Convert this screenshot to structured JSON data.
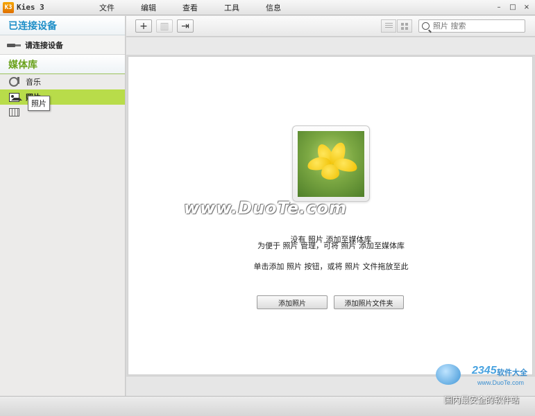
{
  "app": {
    "logo_text": "K3",
    "title": "Kies 3"
  },
  "menu": [
    "文件",
    "编辑",
    "查看",
    "工具",
    "信息"
  ],
  "window_controls": {
    "minimize": "–",
    "maximize": "□",
    "close": "×"
  },
  "sidebar": {
    "connected_header": "已连接设备",
    "device_prompt": "请连接设备",
    "library_header": "媒体库",
    "items": [
      {
        "label": "音乐",
        "icon": "music-icon",
        "selected": false
      },
      {
        "label": "照片",
        "icon": "photo-icon",
        "selected": true
      },
      {
        "label": "视频",
        "icon": "video-icon",
        "selected": false
      }
    ],
    "tooltip": "照片"
  },
  "toolbar": {
    "add_symbol": "+",
    "delete_symbol": "▥",
    "import_symbol": "⇥",
    "search_placeholder": "照片 搜索"
  },
  "content": {
    "watermark": "www.DuoTe.com",
    "empty_title": "没有 照片 添加至媒体库",
    "empty_hint": "为便于 照片 管理，可将 照片 添加至媒体库",
    "empty_instruction": "单击添加 照片 按钮，或将 照片 文件拖放至此",
    "add_button": "添加照片",
    "add_folder_button": "添加照片文件夹"
  },
  "branding": {
    "numbers": "2345",
    "name": "软件大全",
    "url": "www.DuoTe.com",
    "slogan": "国内最安全的软件站"
  },
  "colors": {
    "selected_bg": "#b8dc4a",
    "connected_header": "#1f8fc8",
    "library_header": "#6aa21c"
  }
}
